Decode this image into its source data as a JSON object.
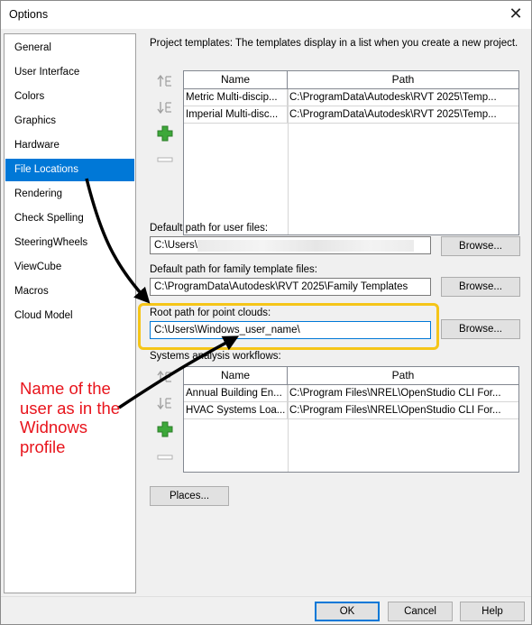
{
  "window": {
    "title": "Options",
    "close_glyph": "✕"
  },
  "sidebar": {
    "items": [
      {
        "label": "General"
      },
      {
        "label": "User Interface"
      },
      {
        "label": "Colors"
      },
      {
        "label": "Graphics"
      },
      {
        "label": "Hardware"
      },
      {
        "label": "File Locations",
        "selected": true
      },
      {
        "label": "Rendering"
      },
      {
        "label": "Check Spelling"
      },
      {
        "label": "SteeringWheels"
      },
      {
        "label": "ViewCube"
      },
      {
        "label": "Macros"
      },
      {
        "label": "Cloud Model"
      }
    ]
  },
  "project_templates": {
    "caption": "Project templates:  The templates display in a list when you create a new project.",
    "columns": [
      "Name",
      "Path"
    ],
    "rows": [
      {
        "name": "Metric Multi-discip...",
        "path": "C:\\ProgramData\\Autodesk\\RVT 2025\\Temp..."
      },
      {
        "name": "Imperial Multi-disc...",
        "path": "C:\\ProgramData\\Autodesk\\RVT 2025\\Temp..."
      }
    ]
  },
  "user_files": {
    "label": "Default path for user files:",
    "value": "C:\\Users\\",
    "browse_label": "Browse..."
  },
  "family_templates": {
    "label": "Default path for family template files:",
    "value": "C:\\ProgramData\\Autodesk\\RVT 2025\\Family Templates",
    "browse_label": "Browse..."
  },
  "point_clouds": {
    "label": "Root path for point clouds:",
    "value": "C:\\Users\\Windows_user_name\\",
    "browse_label": "Browse..."
  },
  "systems_analysis": {
    "caption": "Systems analysis workflows:",
    "columns": [
      "Name",
      "Path"
    ],
    "rows": [
      {
        "name": "Annual Building En...",
        "path": "C:\\Program Files\\NREL\\OpenStudio CLI For..."
      },
      {
        "name": "HVAC Systems Loa...",
        "path": "C:\\Program Files\\NREL\\OpenStudio CLI For..."
      }
    ]
  },
  "places_label": "Places...",
  "footer": {
    "ok_label": "OK",
    "cancel_label": "Cancel",
    "help_label": "Help"
  },
  "annotation": {
    "text": "Name of the user as in the Widnows profile",
    "color": "#e8141c",
    "highlight_color": "#f5c518"
  },
  "accent_color": "#0078d7"
}
